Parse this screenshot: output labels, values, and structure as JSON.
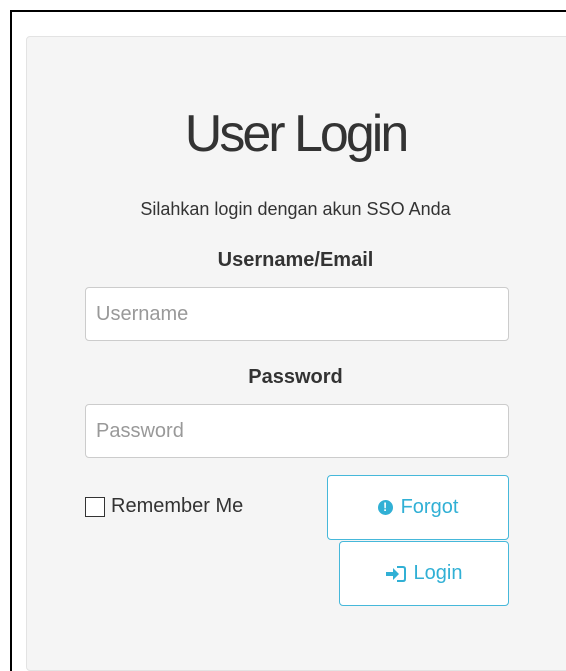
{
  "login": {
    "title": "User Login",
    "subtitle": "Silahkan login dengan akun SSO Anda",
    "username_label": "Username/Email",
    "username_placeholder": "Username",
    "username_value": "",
    "password_label": "Password",
    "password_placeholder": "Password",
    "password_value": "",
    "remember_label": "Remember Me",
    "remember_checked": false,
    "forgot_label": "Forgot",
    "forgot_icon": "exclamation-circle-icon",
    "login_label": "Login",
    "login_icon": "sign-in-icon"
  },
  "colors": {
    "accent": "#31b0d5",
    "panel_background": "#f5f5f5",
    "text": "#333333"
  }
}
